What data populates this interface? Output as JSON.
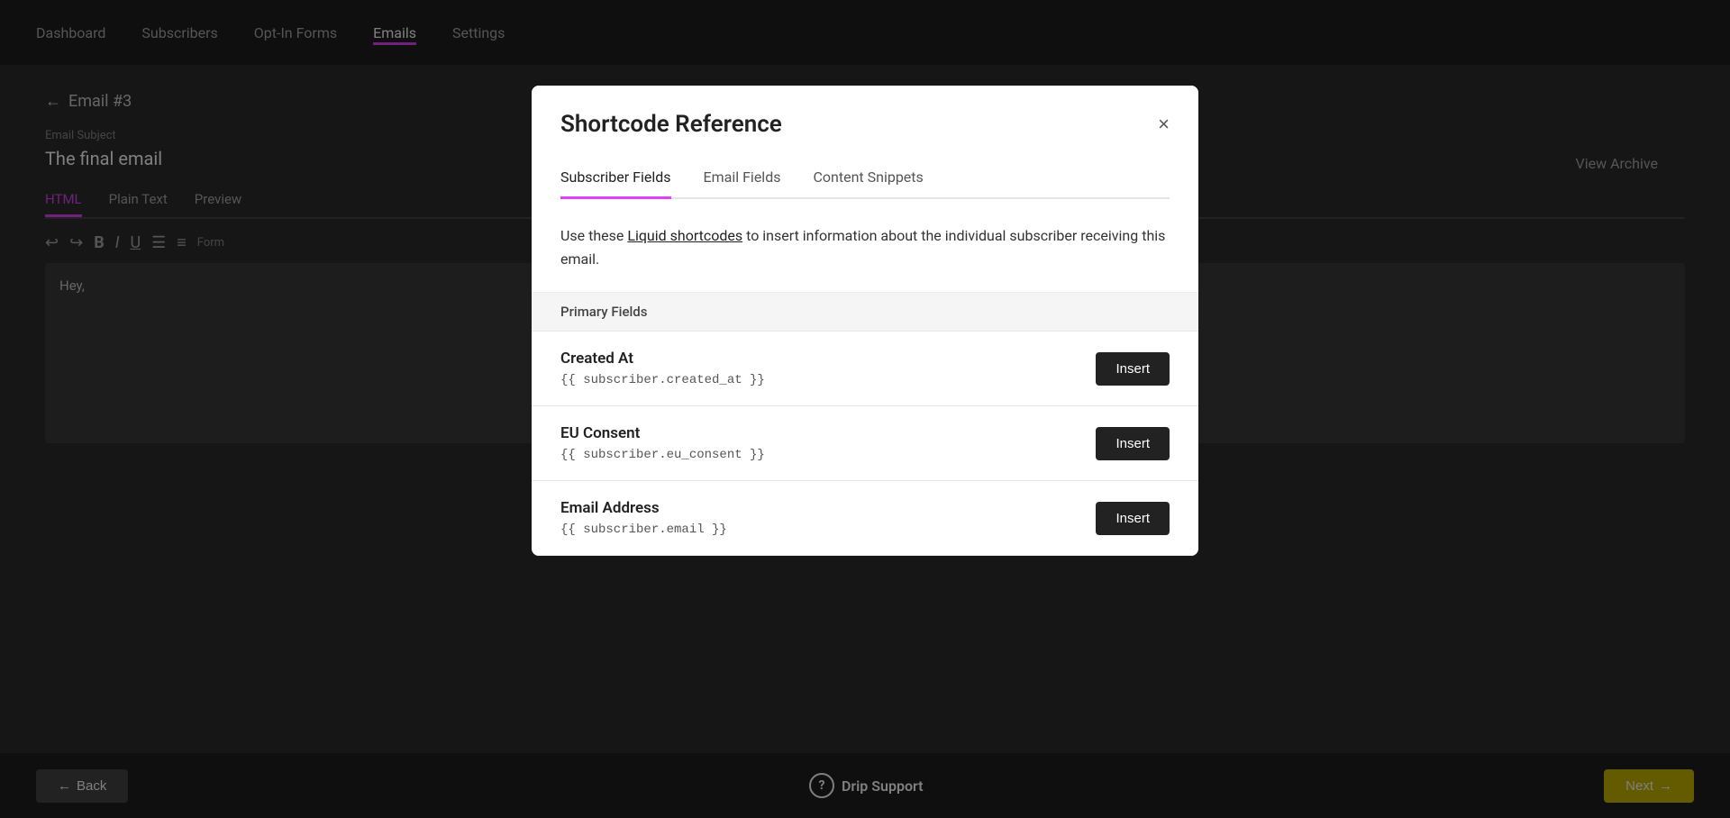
{
  "nav": {
    "items": [
      {
        "label": "Dashboard",
        "active": false
      },
      {
        "label": "Subscribers",
        "active": false
      },
      {
        "label": "Opt-In Forms",
        "active": false
      },
      {
        "label": "Emails",
        "active": true
      },
      {
        "label": "Settings",
        "active": false
      }
    ]
  },
  "editor": {
    "back_link": "Email #3",
    "view_archive": "View Archive",
    "email_subject_label": "Email Subject",
    "email_subject_value": "The final email",
    "tabs": [
      {
        "label": "HTML",
        "active": true
      },
      {
        "label": "Plain Text",
        "active": false
      },
      {
        "label": "Preview",
        "active": false
      }
    ],
    "editor_content": "Hey,"
  },
  "bottom_bar": {
    "back_label": "Back",
    "next_label": "Next"
  },
  "drip_support": {
    "label": "Drip Support",
    "icon": "?"
  },
  "modal": {
    "title": "Shortcode Reference",
    "close_label": "×",
    "tabs": [
      {
        "label": "Subscriber Fields",
        "active": true
      },
      {
        "label": "Email Fields",
        "active": false
      },
      {
        "label": "Content Snippets",
        "active": false
      }
    ],
    "description_prefix": "Use these ",
    "description_link": "Liquid shortcodes",
    "description_suffix": " to insert information about the individual subscriber receiving this email.",
    "section_label": "Primary Fields",
    "fields": [
      {
        "name": "Created At",
        "code": "{{ subscriber.created_at }}",
        "insert_label": "Insert"
      },
      {
        "name": "EU Consent",
        "code": "{{ subscriber.eu_consent }}",
        "insert_label": "Insert"
      },
      {
        "name": "Email Address",
        "code": "{{ subscriber.email }}",
        "insert_label": "Insert"
      }
    ]
  }
}
